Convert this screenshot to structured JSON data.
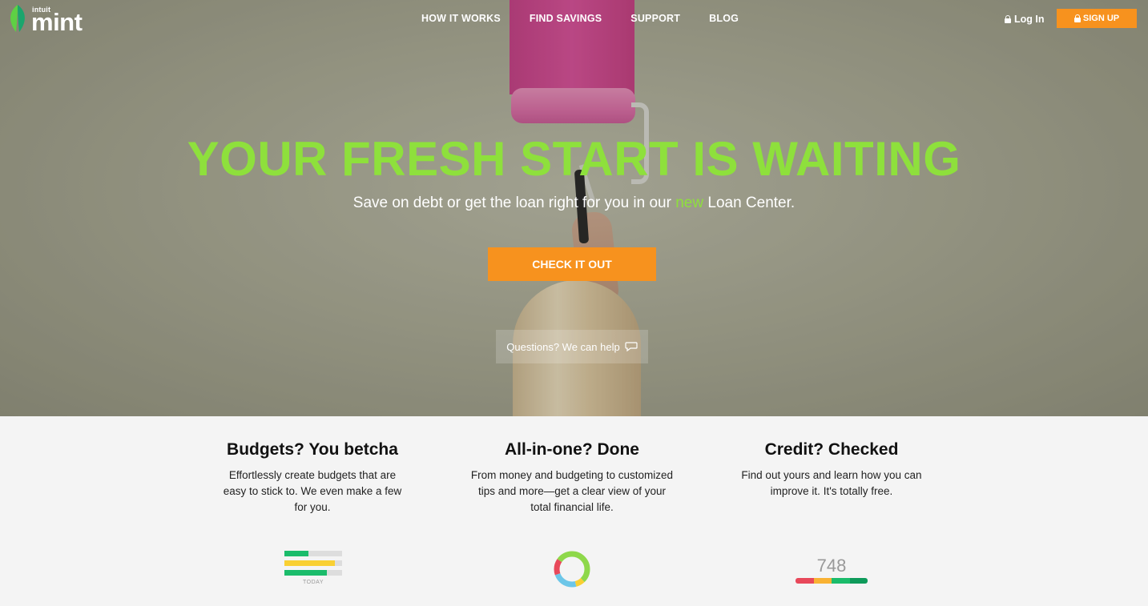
{
  "brand": {
    "company": "intuit",
    "product": "mint"
  },
  "nav": {
    "items": [
      {
        "label": "HOW IT WORKS"
      },
      {
        "label": "FIND SAVINGS"
      },
      {
        "label": "SUPPORT"
      },
      {
        "label": "BLOG"
      }
    ],
    "login_label": "Log In",
    "signup_label": "SIGN UP"
  },
  "hero": {
    "headline": "YOUR FRESH START IS WAITING",
    "subline_before": "Save on debt or get the loan right for you in our ",
    "subline_accent": "new",
    "subline_after": " Loan Center.",
    "cta_label": "CHECK IT OUT",
    "help_label": "Questions? We can help"
  },
  "features": [
    {
      "title": "Budgets? You betcha",
      "body": "Effortlessly create budgets that are easy to stick to. We even make a few for you."
    },
    {
      "title": "All-in-one? Done",
      "body": "From money and budgeting to customized tips and more—get a clear view of your total financial life."
    },
    {
      "title": "Credit? Checked",
      "body": "Find out yours and learn how you can improve it. It's totally free."
    }
  ],
  "budget_widget": {
    "caption": "TODAY",
    "bars": [
      {
        "fill": 0.42,
        "color": "#1bbc6b"
      },
      {
        "fill": 0.88,
        "color": "#f9d033"
      },
      {
        "fill": 0.74,
        "color": "#1bbc6b"
      }
    ]
  },
  "credit_widget": {
    "score": "748"
  },
  "colors": {
    "accent_green": "#8ee03c",
    "cta_orange": "#f7921e"
  }
}
